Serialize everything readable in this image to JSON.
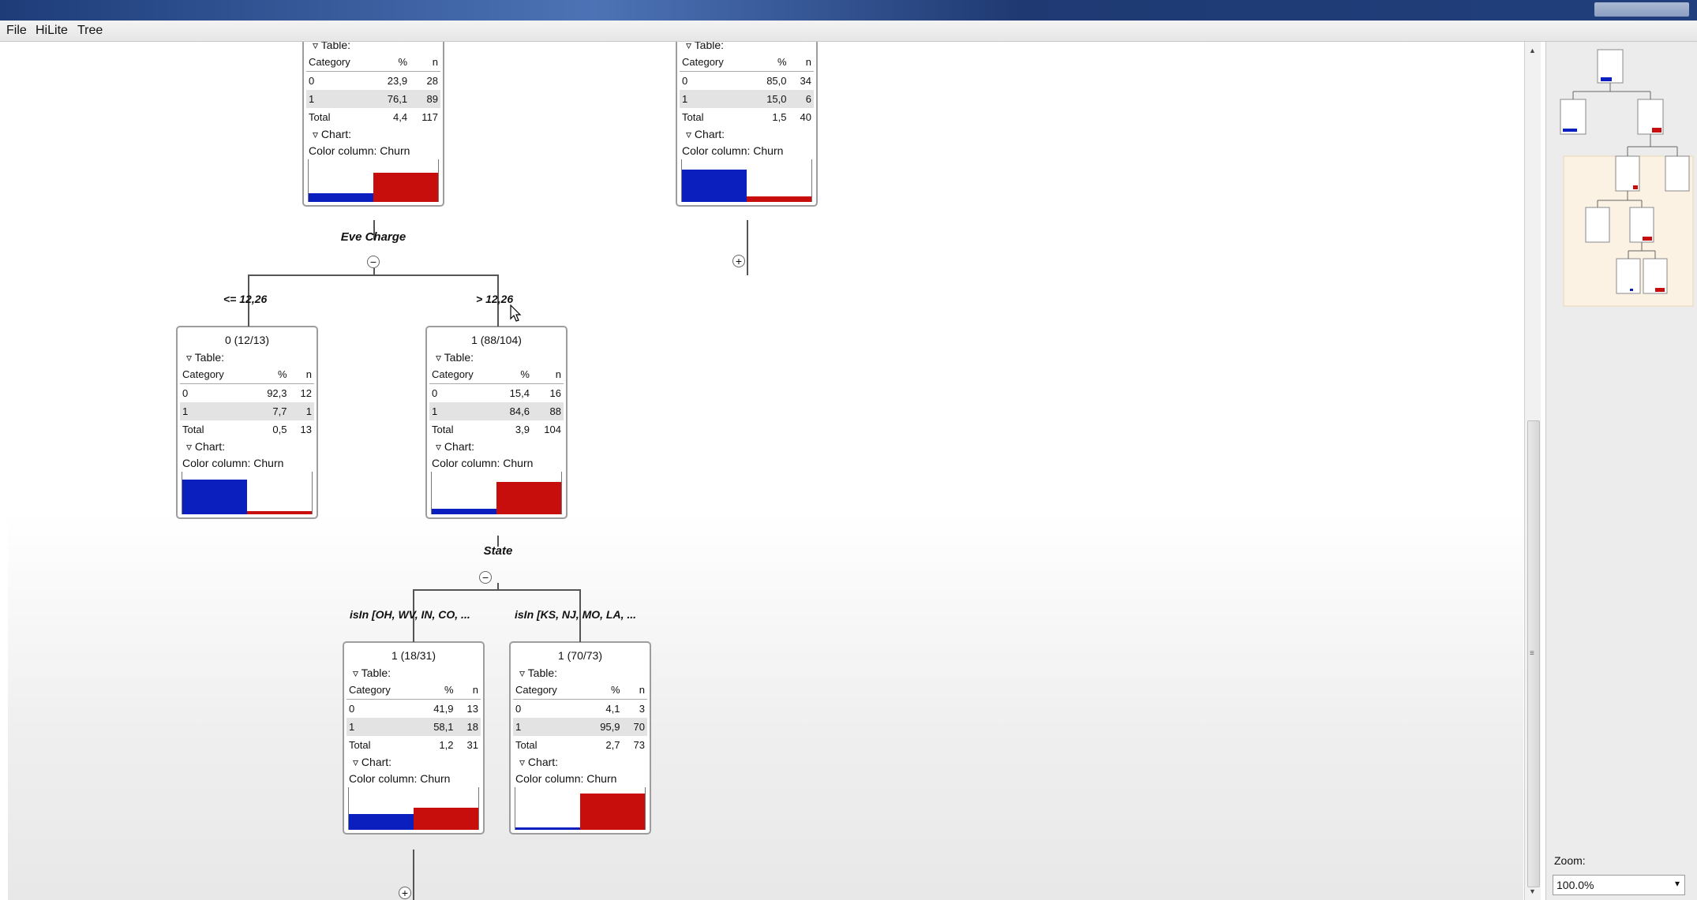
{
  "window": {
    "title": ""
  },
  "menu": [
    "File",
    "HiLite",
    "Tree"
  ],
  "zoom": {
    "label": "Zoom:",
    "value": "100.0%"
  },
  "split_labels": {
    "eve": "Eve Charge",
    "state": "State"
  },
  "edge_labels": {
    "le": "<= 12,26",
    "gt": "> 12,26",
    "isin1": "isIn [OH, WV, IN, CO, ...",
    "isin2": "isIn [KS, NJ, MO, LA, ..."
  },
  "nodes": {
    "top_left": {
      "title": "",
      "table_label": "Table:",
      "headers": [
        "Category",
        "%",
        "n"
      ],
      "rows": [
        [
          "0",
          "23,9",
          "28"
        ],
        [
          "1",
          "76,1",
          "89"
        ]
      ],
      "total": [
        "Total",
        "4,4",
        "117"
      ],
      "chart_label": "Chart:",
      "color_column": "Color column: Churn",
      "bars": [
        0.239,
        0.761
      ]
    },
    "top_right": {
      "title": "",
      "table_label": "Table:",
      "headers": [
        "Category",
        "%",
        "n"
      ],
      "rows": [
        [
          "0",
          "85,0",
          "34"
        ],
        [
          "1",
          "15,0",
          "6"
        ]
      ],
      "total": [
        "Total",
        "1,5",
        "40"
      ],
      "chart_label": "Chart:",
      "color_column": "Color column: Churn",
      "bars": [
        0.85,
        0.15
      ]
    },
    "le": {
      "title": "0 (12/13)",
      "table_label": "Table:",
      "headers": [
        "Category",
        "%",
        "n"
      ],
      "rows": [
        [
          "0",
          "92,3",
          "12"
        ],
        [
          "1",
          "7,7",
          "1"
        ]
      ],
      "total": [
        "Total",
        "0,5",
        "13"
      ],
      "chart_label": "Chart:",
      "color_column": "Color column: Churn",
      "bars": [
        0.923,
        0.077
      ]
    },
    "gt": {
      "title": "1 (88/104)",
      "table_label": "Table:",
      "headers": [
        "Category",
        "%",
        "n"
      ],
      "rows": [
        [
          "0",
          "15,4",
          "16"
        ],
        [
          "1",
          "84,6",
          "88"
        ]
      ],
      "total": [
        "Total",
        "3,9",
        "104"
      ],
      "chart_label": "Chart:",
      "color_column": "Color column: Churn",
      "bars": [
        0.154,
        0.846
      ]
    },
    "isin1": {
      "title": "1 (18/31)",
      "table_label": "Table:",
      "headers": [
        "Category",
        "%",
        "n"
      ],
      "rows": [
        [
          "0",
          "41,9",
          "13"
        ],
        [
          "1",
          "58,1",
          "18"
        ]
      ],
      "total": [
        "Total",
        "1,2",
        "31"
      ],
      "chart_label": "Chart:",
      "color_column": "Color column: Churn",
      "bars": [
        0.419,
        0.581
      ]
    },
    "isin2": {
      "title": "1 (70/73)",
      "table_label": "Table:",
      "headers": [
        "Category",
        "%",
        "n"
      ],
      "rows": [
        [
          "0",
          "4,1",
          "3"
        ],
        [
          "1",
          "95,9",
          "70"
        ]
      ],
      "total": [
        "Total",
        "2,7",
        "73"
      ],
      "chart_label": "Chart:",
      "color_column": "Color column: Churn",
      "bars": [
        0.041,
        0.959
      ]
    }
  },
  "colors": {
    "class0": "#0b1fbf",
    "class1": "#c80d0d",
    "selected_row": "#e3e3e3"
  },
  "icons": {
    "collapse": "minus-circle-icon",
    "expand": "plus-circle-icon",
    "section_toggle": "triangle-down-icon"
  }
}
